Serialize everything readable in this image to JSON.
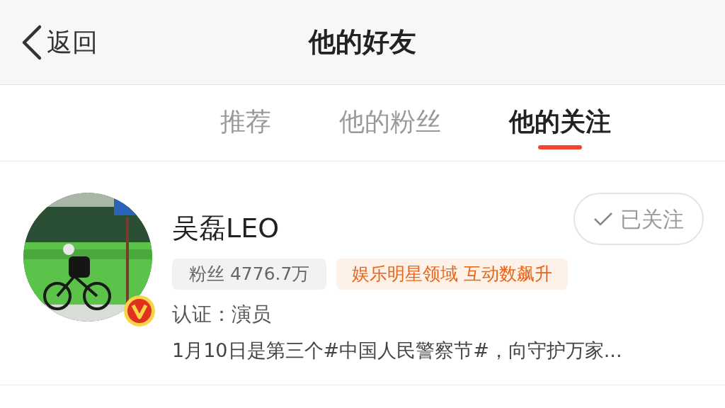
{
  "nav": {
    "back": "返回",
    "title": "他的好友"
  },
  "tabs": [
    {
      "label": "推荐",
      "selected": false
    },
    {
      "label": "他的粉丝",
      "selected": false
    },
    {
      "label": "他的关注",
      "selected": true
    }
  ],
  "users": [
    {
      "name": "吴磊LEO",
      "verified": true,
      "following": true,
      "follow_label": "已关注",
      "fans": "粉丝 4776.7万",
      "tag": "娱乐明星领域 互动数飙升",
      "cert": "认证：演员",
      "post": "1月10日是第三个#中国人民警察节#，向守护万家..."
    }
  ]
}
